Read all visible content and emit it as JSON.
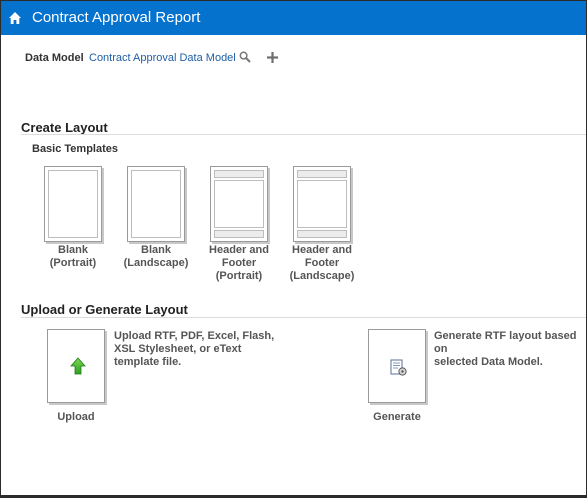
{
  "header": {
    "title": "Contract Approval Report",
    "bg_color": "#0572ce",
    "home_icon": "home-icon"
  },
  "data_model": {
    "label": "Data Model",
    "value": "Contract Approval Data Model",
    "search_icon": "search-icon",
    "add_icon": "plus-icon"
  },
  "create_layout": {
    "heading": "Create Layout",
    "subheading": "Basic Templates",
    "templates": [
      {
        "line1": "Blank",
        "line2": "(Portrait)",
        "line3": ""
      },
      {
        "line1": "Blank",
        "line2": "(Landscape)",
        "line3": ""
      },
      {
        "line1": "Header and",
        "line2": "Footer",
        "line3": "(Portrait)"
      },
      {
        "line1": "Header and",
        "line2": "Footer",
        "line3": "(Landscape)"
      }
    ]
  },
  "upload_generate": {
    "heading": "Upload or Generate Layout",
    "upload": {
      "label": "Upload",
      "desc_line1": "Upload RTF, PDF, Excel, Flash,",
      "desc_line2": "XSL Stylesheet, or eText",
      "desc_line3": "template file.",
      "icon": "up-arrow-icon"
    },
    "generate": {
      "label": "Generate",
      "desc_line1": "Generate RTF layout based on",
      "desc_line2": "selected Data Model.",
      "icon": "generate-document-icon"
    }
  }
}
